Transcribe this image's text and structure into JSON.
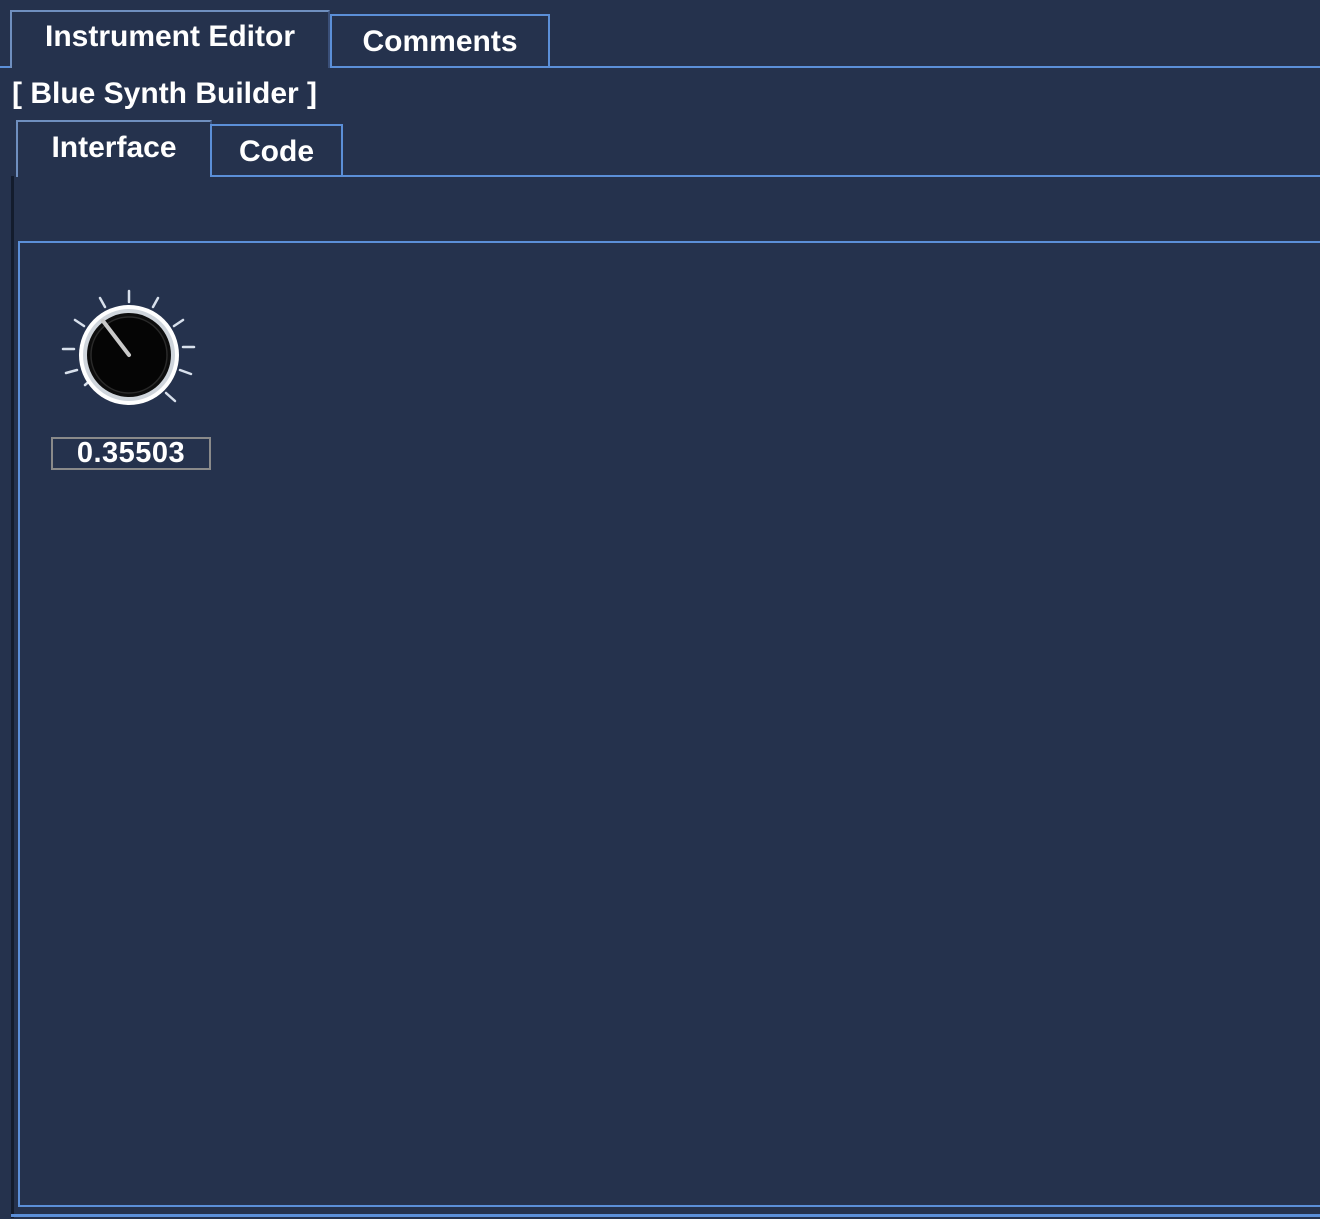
{
  "top_tabs": [
    {
      "label": "Instrument Editor",
      "selected": true
    },
    {
      "label": "Comments",
      "selected": false
    }
  ],
  "instrument_title": "[ Blue Synth Builder ]",
  "inner_tabs": [
    {
      "label": "Interface",
      "selected": true
    },
    {
      "label": "Code",
      "selected": false
    }
  ],
  "knob": {
    "value": "0.35503",
    "icon": "knob-icon"
  },
  "colors": {
    "background": "#25324d",
    "accent": "#5b8fd8",
    "text": "#ffffff",
    "value_box_border": "#8a8a8a"
  }
}
